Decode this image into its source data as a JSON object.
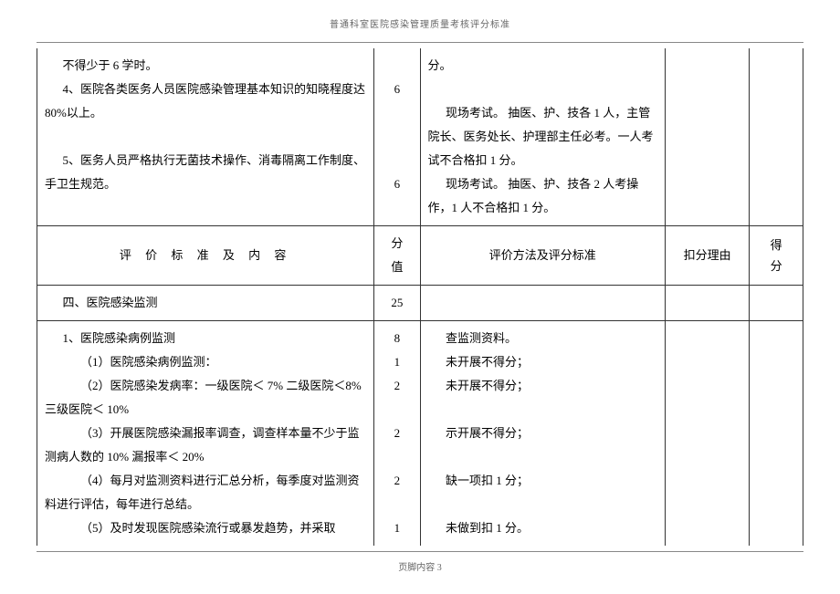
{
  "header_title": "普通科室医院感染管理质量考核评分标准",
  "row1": {
    "criteria_l1": "不得少于 6 学时。",
    "criteria_l2": "4、医院各类医务人员医院感染管理基本知识的知晓程度达 80%以上。",
    "criteria_l3": "5、医务人员严格执行无菌技术操作、消毒隔离工作制度、手卫生规范。",
    "score1": "6",
    "score2": "6",
    "method_l1": "分。",
    "method_l2": "现场考试。 抽医、护、技各 1 人，主管院长、医务处长、护理部主任必考。一人考试不合格扣 1 分。",
    "method_l3": "现场考试。 抽医、护、技各 2 人考操作，1 人不合格扣 1 分。"
  },
  "row_header": {
    "c1": "评 价 标 准 及 内 容",
    "c2a": "分",
    "c2b": "值",
    "c3": "评价方法及评分标准",
    "c4": "扣分理由",
    "c5a": "得",
    "c5b": "分"
  },
  "row_section": {
    "title": "四、医院感染监测",
    "score": "25"
  },
  "row_body": {
    "c1_l1": "1、医院感染病例监测",
    "c1_l2": "（1）医院感染病例监测：",
    "c1_l3": "（2）医院感染发病率：一级医院＜ 7% 二级医院＜8% 三级医院＜ 10%",
    "c1_l4": "（3）开展医院感染漏报率调查，调查样本量不少于监测病人数的 10% 漏报率＜ 20%",
    "c1_l5": "（4）每月对监测资料进行汇总分析，每季度对监测资料进行评估，每年进行总结。",
    "c1_l6": "（5）及时发现医院感染流行或暴发趋势，并采取",
    "s1": "8",
    "s2": "1",
    "s3": "2",
    "s4": "2",
    "s5": "2",
    "s6": "1",
    "m1": "查监测资料。",
    "m2": "未开展不得分；",
    "m3": "未开展不得分；",
    "m4": "示开展不得分；",
    "m5": "缺一项扣 1 分；",
    "m6": "未做到扣 1 分。"
  },
  "footer": "页脚内容 3"
}
